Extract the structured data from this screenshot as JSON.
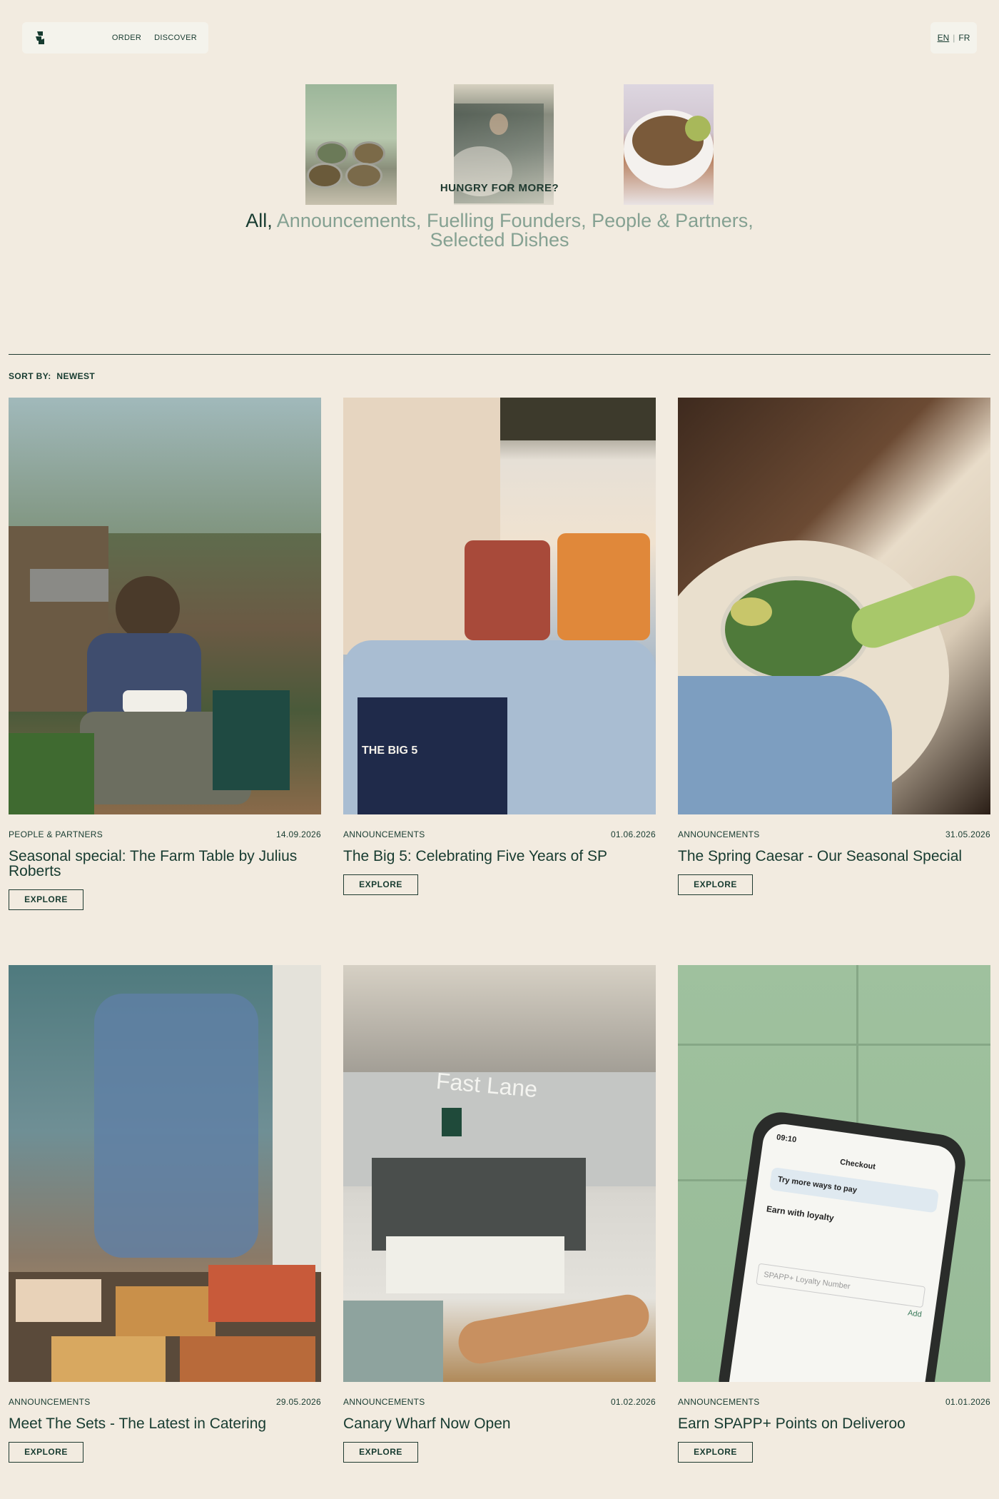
{
  "header": {
    "nav": [
      {
        "label": "ORDER"
      },
      {
        "label": "DISCOVER"
      }
    ],
    "languages": {
      "active": "EN",
      "separator": "|",
      "other": "FR"
    }
  },
  "hero": {
    "heading": "HUNGRY FOR MORE?",
    "filters": [
      {
        "label": "All,",
        "active": true
      },
      {
        "label": "Announcements,",
        "active": false
      },
      {
        "label": "Fuelling Founders,",
        "active": false
      },
      {
        "label": "People & Partners,",
        "active": false
      },
      {
        "label": "Selected Dishes",
        "active": false
      }
    ]
  },
  "sort": {
    "label": "SORT BY:",
    "value": "NEWEST"
  },
  "posts": [
    {
      "category": "PEOPLE & PARTNERS",
      "date": "14.09.2026",
      "title": "Seasonal special: The Farm Table by Julius Roberts",
      "cta": "EXPLORE"
    },
    {
      "category": "ANNOUNCEMENTS",
      "date": "01.06.2026",
      "title": "The Big 5: Celebrating Five Years of SP",
      "cta": "EXPLORE"
    },
    {
      "category": "ANNOUNCEMENTS",
      "date": "31.05.2026",
      "title": "The Spring Caesar - Our Seasonal Special",
      "cta": "EXPLORE"
    },
    {
      "category": "ANNOUNCEMENTS",
      "date": "29.05.2026",
      "title": "Meet The Sets - The Latest in Catering",
      "cta": "EXPLORE"
    },
    {
      "category": "ANNOUNCEMENTS",
      "date": "01.02.2026",
      "title": "Canary Wharf Now Open",
      "cta": "EXPLORE"
    },
    {
      "category": "ANNOUNCEMENTS",
      "date": "01.01.2026",
      "title": "Earn SPAPP+ Points on Deliveroo",
      "cta": "EXPLORE"
    }
  ],
  "image_text": {
    "apron": "THE BIG 5",
    "store_sign": "Fast Lane",
    "phone_time": "09:10",
    "phone_title": "Checkout",
    "phone_pay": "Try more ways to pay",
    "phone_loyalty": "Earn with loyalty",
    "phone_field": "SPAPP+ Loyalty Number",
    "phone_add": "Add"
  },
  "colors": {
    "background": "#f2ebe0",
    "text": "#173b30",
    "muted": "#85a192"
  }
}
